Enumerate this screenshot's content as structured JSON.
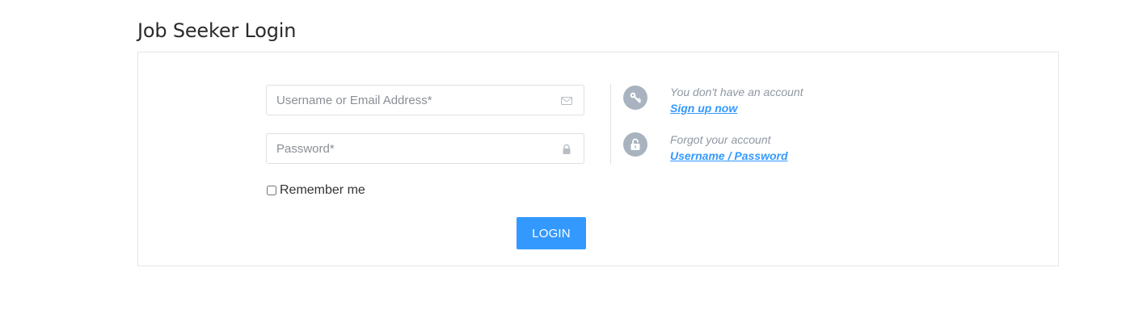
{
  "page": {
    "title": "Job Seeker Login"
  },
  "form": {
    "username_placeholder": "Username or Email Address*",
    "username_value": "",
    "password_placeholder": "Password*",
    "password_value": "",
    "remember_label": "Remember me",
    "remember_checked": false,
    "login_label": "LOGIN"
  },
  "help": {
    "signup_prompt": "You don't have an account",
    "signup_link": "Sign up now",
    "forgot_prompt": "Forgot your account",
    "forgot_link": "Username / Password"
  },
  "icons": {
    "username": "envelope-icon",
    "password": "lock-icon",
    "signup": "key-icon",
    "forgot": "unlock-icon"
  },
  "colors": {
    "accent": "#3399ff",
    "icon_circle": "#a8b3bf",
    "muted_text": "#8f98a3",
    "border": "#e6e6e6"
  }
}
